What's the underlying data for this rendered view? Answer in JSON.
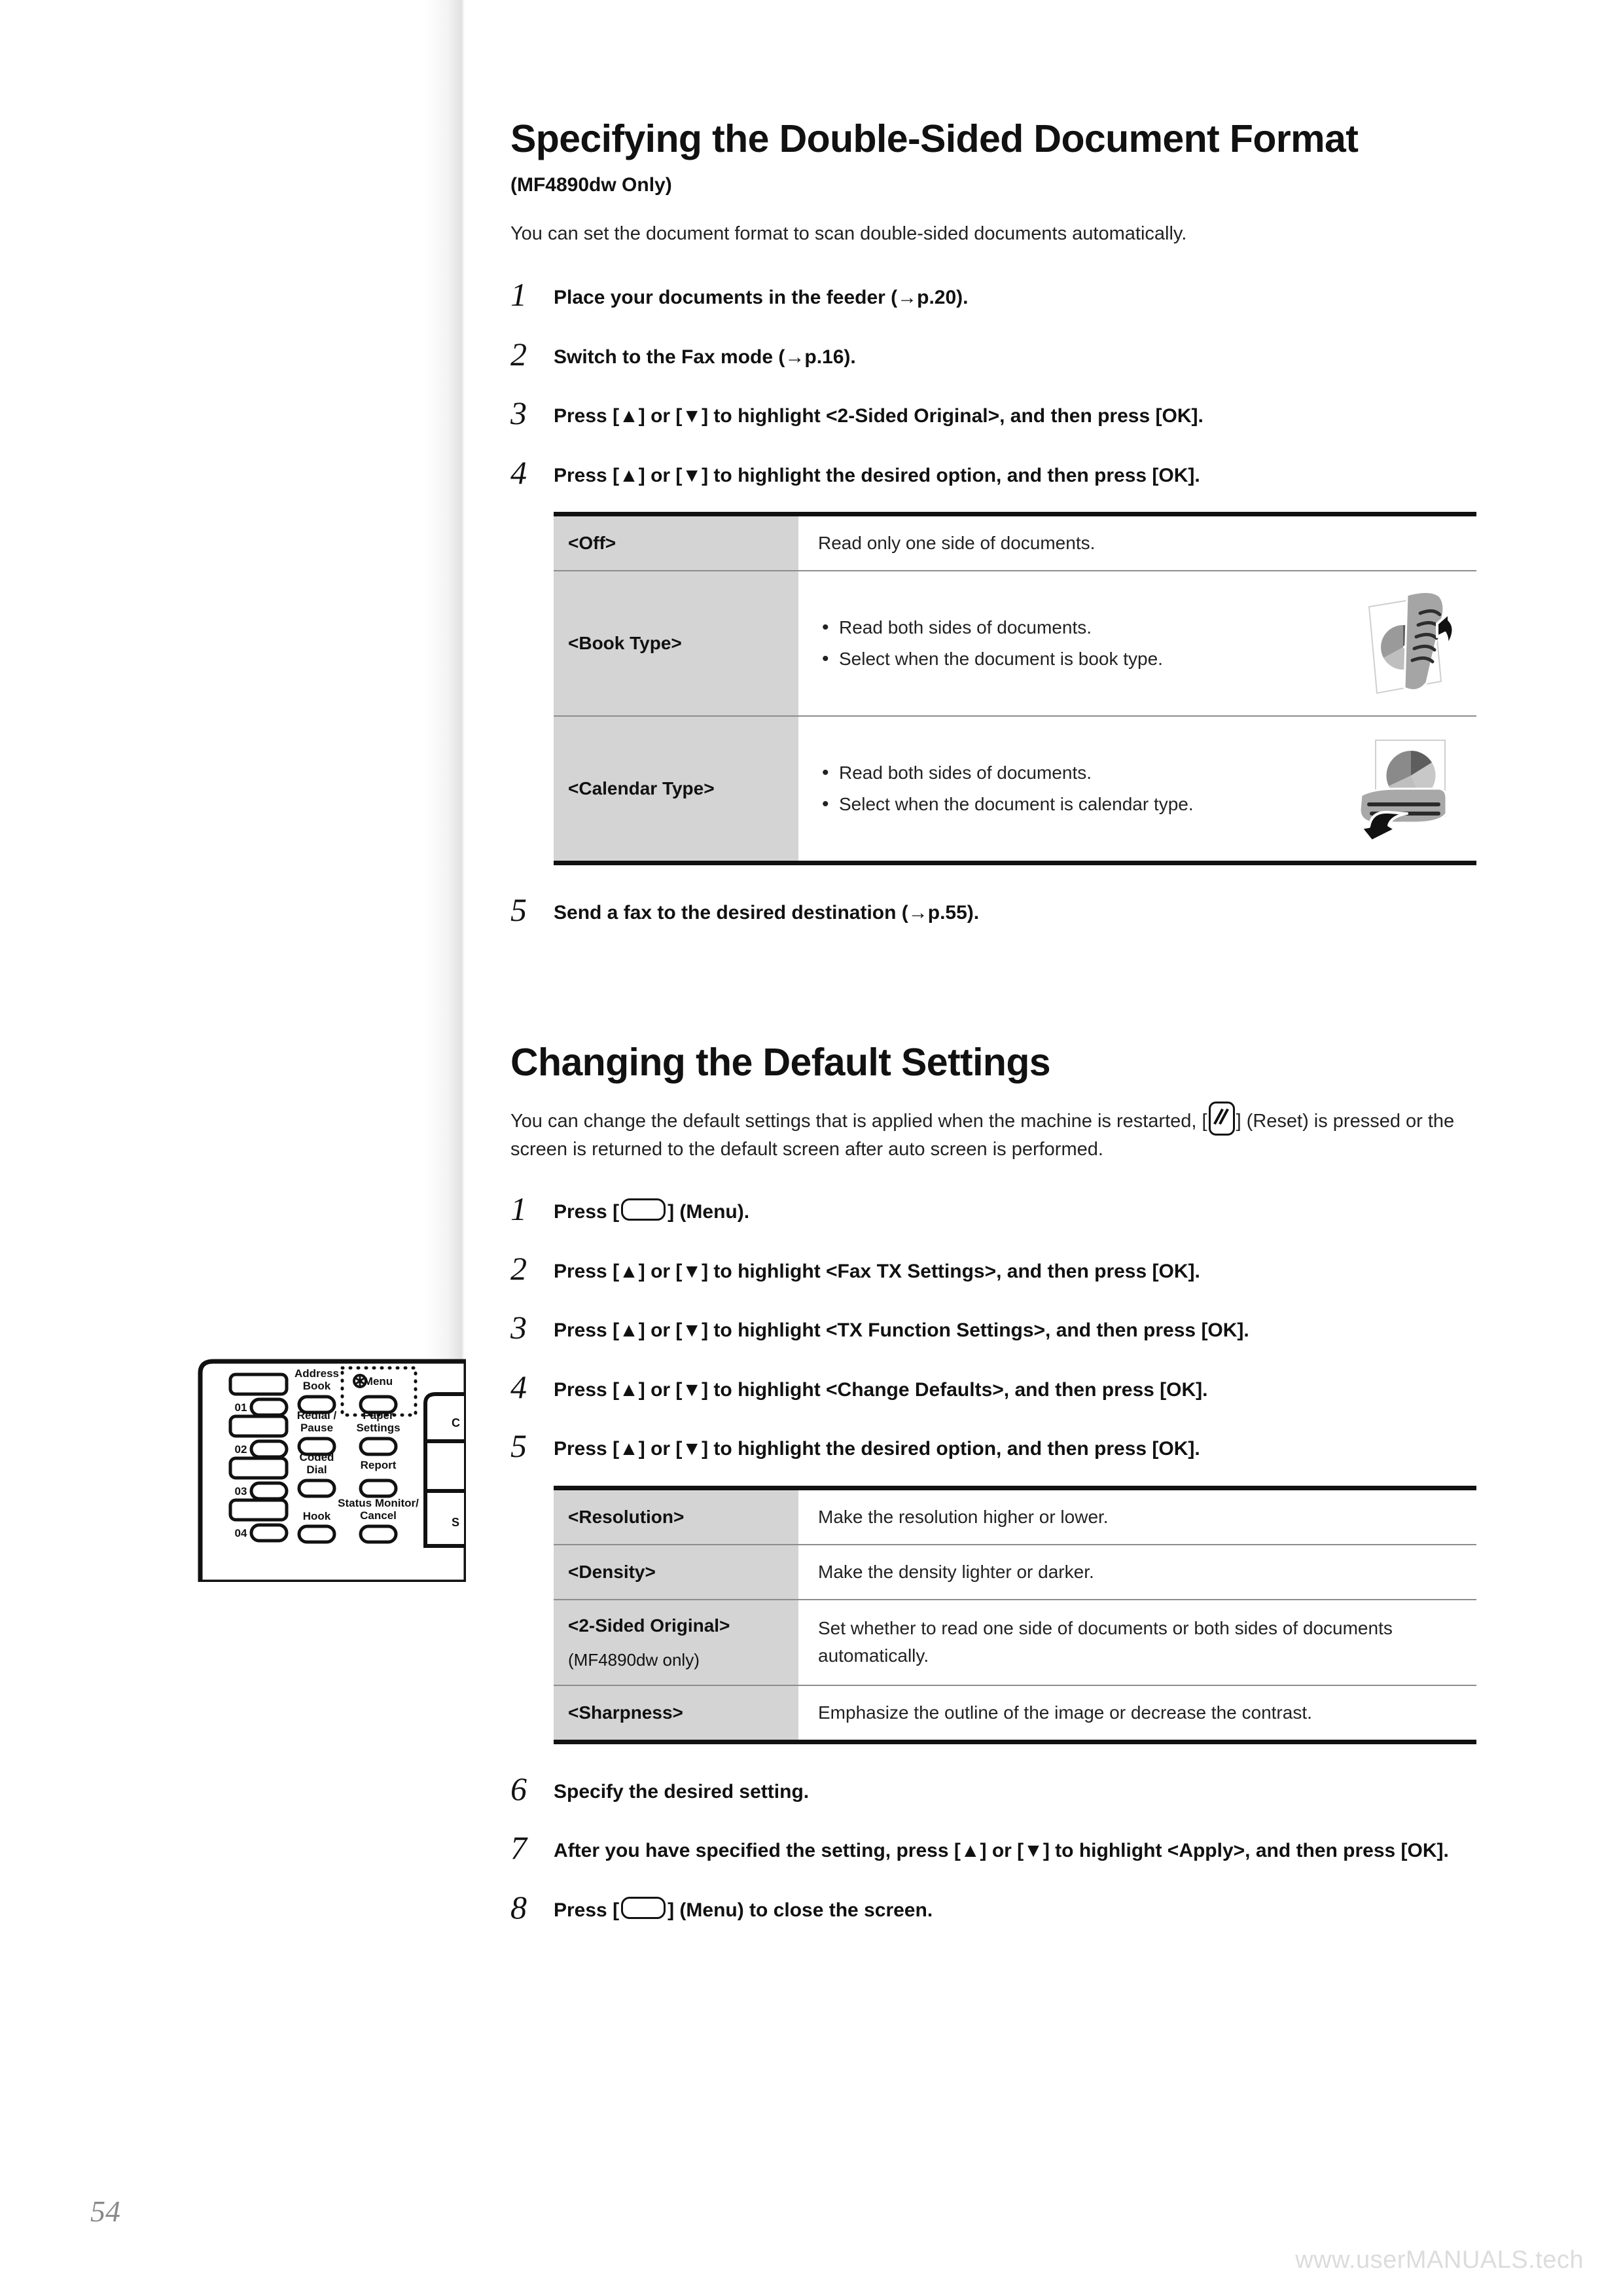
{
  "page": {
    "number": "54",
    "watermark": "www.userMANUALS.tech"
  },
  "section1": {
    "title": "Specifying the Double-Sided Document Format",
    "subtitle": "(MF4890dw Only)",
    "intro": "You can set the document format to scan double-sided documents automatically.",
    "steps": [
      {
        "num": "1",
        "text": "Place your documents in the feeder (→p.20)."
      },
      {
        "num": "2",
        "text": "Switch to the Fax mode (→p.16)."
      },
      {
        "num": "3",
        "text": "Press [▲] or [▼] to highlight <2-Sided Original>, and then press [OK]."
      },
      {
        "num": "4",
        "text": "Press [▲] or [▼] to highlight the desired option, and then press [OK]."
      },
      {
        "num": "5",
        "text": "Send a fax to the desired destination (→p.55)."
      }
    ],
    "table": {
      "rows": [
        {
          "key": "<Off>",
          "bullets": [
            "Read only one side of documents."
          ],
          "figure": "none"
        },
        {
          "key": "<Book Type>",
          "bullets": [
            "Read both sides of documents.",
            "Select when the document is book type."
          ],
          "figure": "book-type-illustration"
        },
        {
          "key": "<Calendar Type>",
          "bullets": [
            "Read both sides of documents.",
            "Select when the document is calendar type."
          ],
          "figure": "calendar-type-illustration"
        }
      ]
    }
  },
  "section2": {
    "title": "Changing the Default Settings",
    "intro_part1": "You can change the default settings that is applied when the machine is restarted, [",
    "intro_part2": "] (Reset) is pressed or the screen is returned to the default screen after auto screen is performed.",
    "steps": [
      {
        "num": "1",
        "pre": "Press [",
        "post": "] (Menu)."
      },
      {
        "num": "2",
        "text": "Press [▲] or [▼] to highlight <Fax TX Settings>, and then press [OK]."
      },
      {
        "num": "3",
        "text": "Press [▲] or [▼] to highlight <TX Function Settings>, and then press [OK]."
      },
      {
        "num": "4",
        "text": "Press [▲] or [▼] to highlight <Change Defaults>, and then press [OK]."
      },
      {
        "num": "5",
        "text": "Press [▲] or [▼] to highlight the desired option, and then press [OK]."
      },
      {
        "num": "6",
        "text": "Specify the desired setting."
      },
      {
        "num": "7",
        "text": "After you have specified the setting, press [▲] or [▼] to highlight <Apply>, and then press [OK]."
      },
      {
        "num": "8",
        "pre": "Press [",
        "post": "] (Menu) to close the screen."
      }
    ],
    "table": {
      "rows": [
        {
          "key": "<Resolution>",
          "keysub": "",
          "value": "Make the resolution higher or lower."
        },
        {
          "key": "<Density>",
          "keysub": "",
          "value": "Make the density lighter or darker."
        },
        {
          "key": "<2-Sided Original>",
          "keysub": "(MF4890dw only)",
          "value": "Set whether to read one side of documents or both sides of documents automatically."
        },
        {
          "key": "<Sharpness>",
          "keysub": "",
          "value": "Emphasize the outline of the image or decrease the contrast."
        }
      ]
    }
  },
  "control_panel": {
    "one_touch_labels": [
      "01",
      "02",
      "03",
      "04"
    ],
    "buttons": [
      {
        "label": "Address Book"
      },
      {
        "label": "Redial/ Pause"
      },
      {
        "label": "Coded Dial"
      },
      {
        "label": "Hook"
      },
      {
        "label": "Menu",
        "highlighted": true
      },
      {
        "label": "Paper Settings"
      },
      {
        "label": "Report"
      },
      {
        "label": "Status Monitor/ Cancel"
      }
    ],
    "right_column_partial": [
      "C",
      "S"
    ]
  },
  "colors": {
    "table_key_bg": "#d4d4d4",
    "rule_dark": "#111111",
    "rule_light": "#8d8d8d",
    "folio": "#8a8a8a",
    "watermark": "#dcdcdc"
  }
}
